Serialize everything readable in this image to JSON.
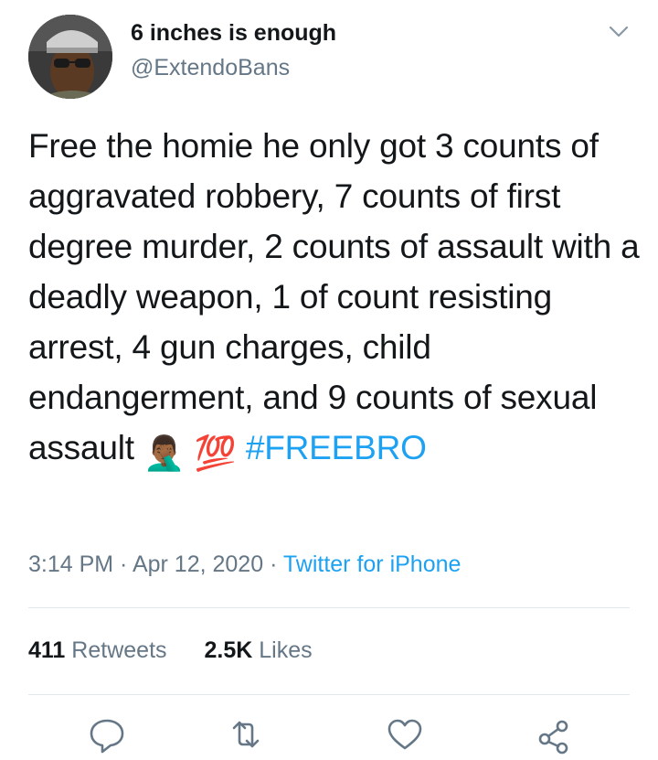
{
  "header": {
    "display_name": "6 inches is enough",
    "handle": "@ExtendoBans"
  },
  "tweet": {
    "text_main": "Free the homie he only got 3 counts of aggravated robbery, 7 counts of first degree murder, 2 counts of assault with a deadly weapon, 1 of count resisting arrest, 4 gun charges, child endangerment, and 9 counts of sexual assault ",
    "emoji_facepalm": "🤦🏾‍♂️",
    "emoji_hundred": "💯",
    "hashtag": "#FREEBRO",
    "time": "3:14 PM",
    "date": "Apr 12, 2020",
    "source": "Twitter for iPhone",
    "separator": " · "
  },
  "stats": {
    "retweets_count": "411",
    "retweets_label": "Retweets",
    "likes_count": "2.5K",
    "likes_label": "Likes"
  },
  "actions": {
    "icons": [
      "reply-icon",
      "retweet-icon",
      "like-icon",
      "share-icon"
    ],
    "icon_color": "#657786"
  },
  "colors": {
    "text": "#14171a",
    "secondary": "#657786",
    "link": "#1da1f2",
    "divider": "#e1e8ed"
  }
}
